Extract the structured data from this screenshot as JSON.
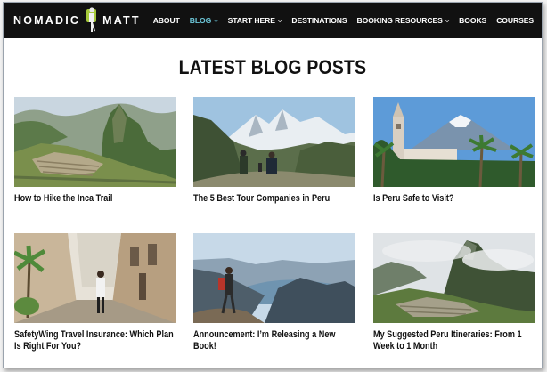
{
  "header": {
    "logo_left": "NOMADIC",
    "logo_right": "MATT",
    "nav": [
      {
        "label": "ABOUT",
        "has_caret": false,
        "active": false
      },
      {
        "label": "BLOG",
        "has_caret": true,
        "active": true
      },
      {
        "label": "START HERE",
        "has_caret": true,
        "active": false
      },
      {
        "label": "DESTINATIONS",
        "has_caret": false,
        "active": false
      },
      {
        "label": "BOOKING RESOURCES",
        "has_caret": true,
        "active": false
      },
      {
        "label": "BOOKS",
        "has_caret": false,
        "active": false
      },
      {
        "label": "COURSES",
        "has_caret": false,
        "active": false
      }
    ],
    "caret_glyph": "⌵"
  },
  "main": {
    "section_title": "LATEST BLOG POSTS",
    "posts": [
      {
        "title": "How to Hike the Inca Trail",
        "image": "machu-picchu-terraces"
      },
      {
        "title": "The 5 Best Tour Companies in Peru",
        "image": "hikers-snowy-mountains"
      },
      {
        "title": "Is Peru Safe to Visit?",
        "image": "arequipa-cathedral-volcano"
      },
      {
        "title": "SafetyWing Travel Insurance: Which Plan Is Right For You?",
        "image": "cobblestone-street-walker"
      },
      {
        "title": "Announcement: I’m Releasing a New Book!",
        "image": "hiker-overlooking-lake"
      },
      {
        "title": "My Suggested Peru Itineraries: From 1 Week to 1 Month",
        "image": "machu-picchu-clouds"
      }
    ]
  },
  "colors": {
    "header_bg": "#111111",
    "nav_text": "#ffffff",
    "nav_active": "#6cc6d8",
    "title_text": "#111111"
  }
}
